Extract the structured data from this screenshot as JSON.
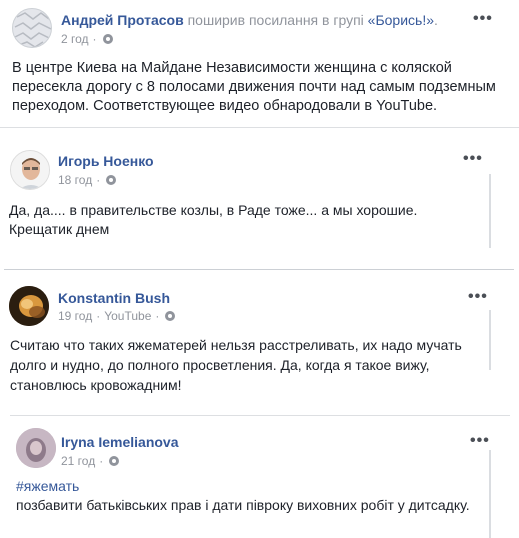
{
  "posts": [
    {
      "author": "Андрей Протасов",
      "action": "поширив посилання в групі",
      "group": "«Борись!»",
      "suffix": ".",
      "time": "2 год",
      "text": "В центре Киева на Майдане Независимости женщина с коляской пересекла дорогу с 8 полосами движения почти над самым подземным переходом. Соответствующее видео обнародовали в YouTube."
    },
    {
      "author": "Игорь Ноенко",
      "time": "18 год",
      "text": "Да, да.... в правительстве козлы, в Раде тоже... а мы хорошие. Крещатик днем"
    },
    {
      "author": "Konstantin Bush",
      "time": "19 год",
      "source": "YouTube",
      "text": "Считаю что таких яжематерей нельзя расстреливать, их надо мучать долго и нудно, до полного просветления. Да, когда я такое вижу, становлюсь кровожадним!"
    },
    {
      "author": "Iryna Iemelianova",
      "time": "21 год",
      "hashtag": "#яжемать",
      "text": "позбавити батьківських прав і дати півроку виховних робіт у дитсадку."
    }
  ],
  "icons": {
    "globe": "globe-icon",
    "more": "more-options-icon"
  },
  "more_label": "•••",
  "separator": "·",
  "colors": {
    "link": "#365899",
    "muted": "#90949c",
    "text": "#1d2129"
  }
}
